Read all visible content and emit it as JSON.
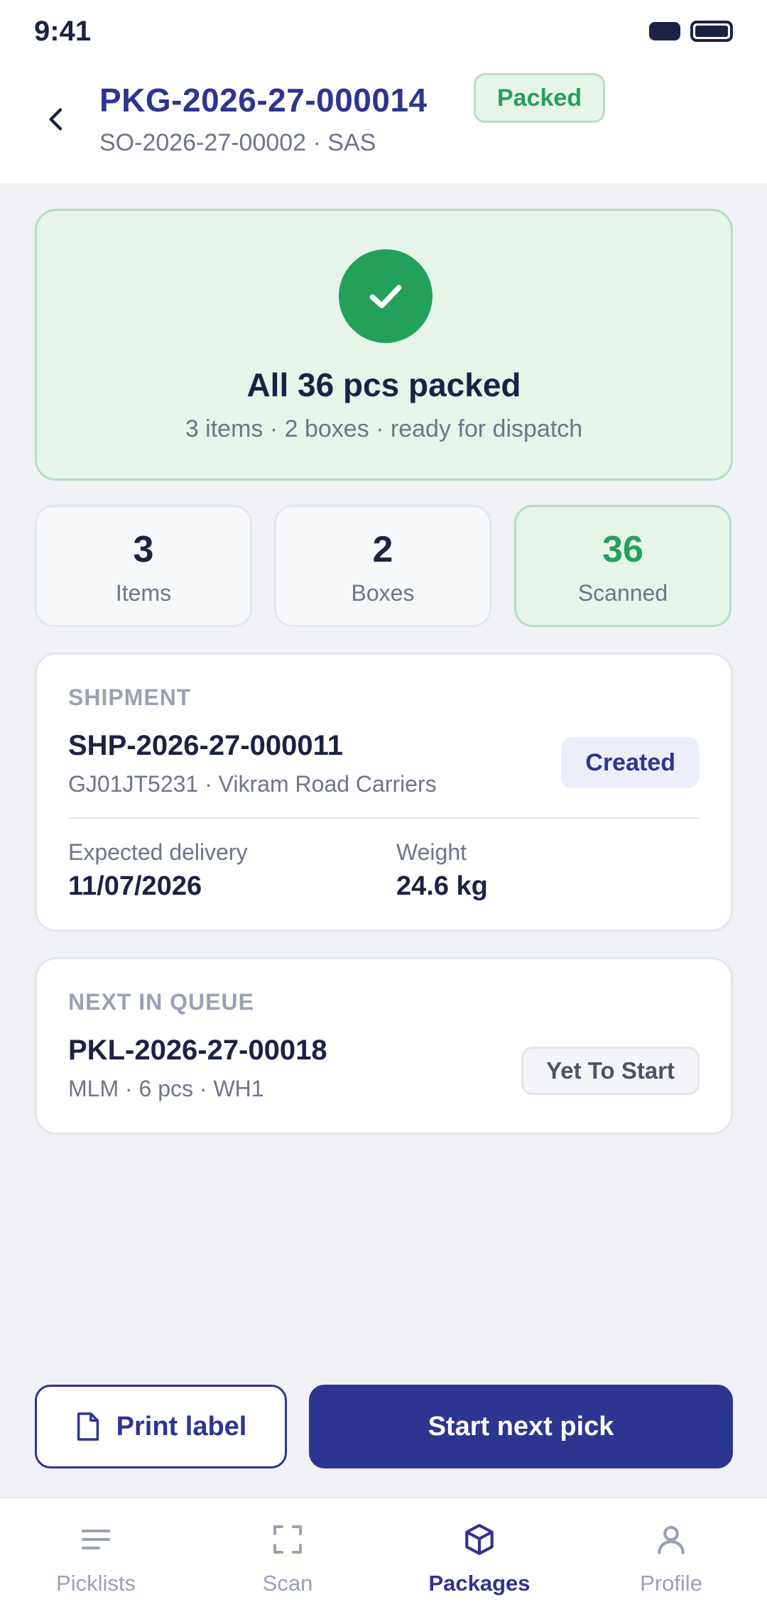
{
  "status_bar": {
    "time": "9:41"
  },
  "header": {
    "title": "PKG-2026-27-000014",
    "status": "Packed",
    "subtitle": "SO-2026-27-00002 · SAS"
  },
  "success": {
    "title": "All 36 pcs packed",
    "subtitle": "3 items · 2 boxes · ready for dispatch"
  },
  "stats": [
    {
      "value": "3",
      "label": "Items"
    },
    {
      "value": "2",
      "label": "Boxes"
    },
    {
      "value": "36",
      "label": "Scanned"
    }
  ],
  "shipment": {
    "section": "SHIPMENT",
    "id": "SHP-2026-27-000011",
    "detail": "GJ01JT5231 · Vikram Road Carriers",
    "status": "Created",
    "expected_label": "Expected delivery",
    "expected_value": "11/07/2026",
    "weight_label": "Weight",
    "weight_value": "24.6 kg"
  },
  "queue": {
    "section": "NEXT IN QUEUE",
    "id": "PKL-2026-27-00018",
    "detail": "MLM · 6 pcs · WH1",
    "status": "Yet To Start"
  },
  "actions": {
    "print_label": "Print label",
    "start_next": "Start next pick"
  },
  "nav": [
    {
      "label": "Picklists",
      "icon": "list-icon"
    },
    {
      "label": "Scan",
      "icon": "scan-icon"
    },
    {
      "label": "Packages",
      "icon": "package-icon",
      "active": true
    },
    {
      "label": "Profile",
      "icon": "profile-icon"
    }
  ],
  "colors": {
    "primary": "#2c3590",
    "success": "#23a158",
    "success_bg": "#e6f4ea",
    "muted": "#6e7588"
  }
}
